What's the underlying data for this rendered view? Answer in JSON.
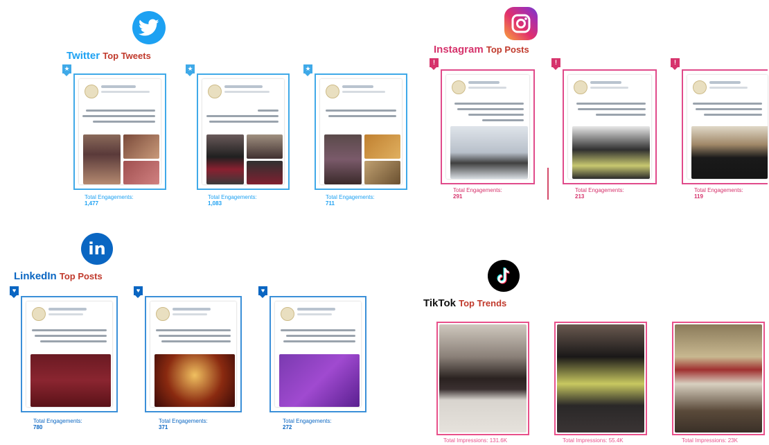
{
  "colors": {
    "twitter": "#1da1f2",
    "instagram_border": "#e04a8a",
    "instagram_text": "#d6336c",
    "linkedin": "#0a66c2",
    "linkedin_border": "#3a8fd8",
    "tiktok_border": "#e8508a",
    "subtitle": "#c0392b"
  },
  "twitter": {
    "brand": "Twitter",
    "subtitle": "Top Tweets",
    "icon": "twitter-bird-icon",
    "posts": [
      {
        "label": "Total Engagements:",
        "value": "1,477"
      },
      {
        "label": "Total Engagements:",
        "value": "1,083"
      },
      {
        "label": "Total Engagements:",
        "value": "711"
      }
    ]
  },
  "instagram": {
    "brand": "Instagram",
    "subtitle": "Top Posts",
    "icon": "instagram-camera-icon",
    "posts": [
      {
        "label": "Total Engagements:",
        "value": "291"
      },
      {
        "label": "Total Engagements:",
        "value": "213"
      },
      {
        "label": "Total Engagements:",
        "value": "119"
      }
    ]
  },
  "linkedin": {
    "brand": "LinkedIn",
    "subtitle": "Top Posts",
    "icon_text": "in",
    "posts": [
      {
        "label": "Total Engagements:",
        "value": "780"
      },
      {
        "label": "Total Engagements:",
        "value": "371"
      },
      {
        "label": "Total Engagements:",
        "value": "272"
      }
    ]
  },
  "tiktok": {
    "brand": "TikTok",
    "subtitle": "Top Trends",
    "icon": "tiktok-note-icon",
    "posts": [
      {
        "label": "Total Impressions: 131.6K"
      },
      {
        "label": "Total Impressions: 55.4K"
      },
      {
        "label": "Total Impressions: 23K"
      }
    ]
  }
}
